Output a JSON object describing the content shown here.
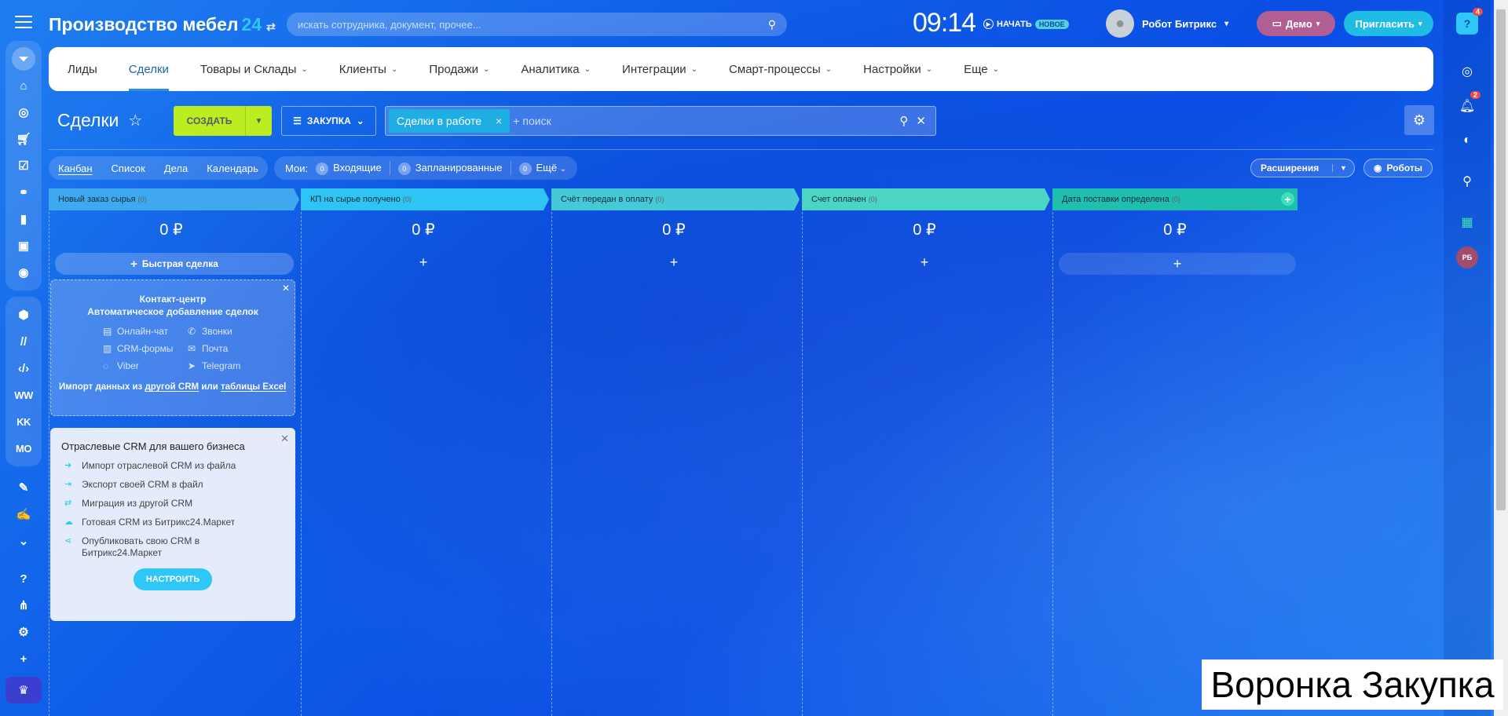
{
  "header": {
    "title": "Производство мебел",
    "title_suffix": "24",
    "search_placeholder": "искать сотрудника, документ, прочее...",
    "clock": "09:14",
    "start_label": "НАЧАТЬ",
    "new_badge": "НОВОЕ",
    "user_name": "Робот Битрикс",
    "demo_label": "Демо",
    "invite_label": "Пригласить"
  },
  "sidebar": {
    "text_items": [
      "WW",
      "KK",
      "MO"
    ]
  },
  "right_panel": {
    "help_badge": "4",
    "bell_badge": "2",
    "avatar_initials": "РБ"
  },
  "nav": {
    "items": [
      {
        "label": "Лиды",
        "dropdown": false
      },
      {
        "label": "Сделки",
        "dropdown": false,
        "active": true
      },
      {
        "label": "Товары и Склады",
        "dropdown": true
      },
      {
        "label": "Клиенты",
        "dropdown": true
      },
      {
        "label": "Продажи",
        "dropdown": true
      },
      {
        "label": "Аналитика",
        "dropdown": true
      },
      {
        "label": "Интеграции",
        "dropdown": true
      },
      {
        "label": "Смарт-процессы",
        "dropdown": true
      },
      {
        "label": "Настройки",
        "dropdown": true
      },
      {
        "label": "Еще",
        "dropdown": true
      }
    ]
  },
  "toolbar": {
    "page_title": "Сделки",
    "create_label": "СОЗДАТЬ",
    "funnel_label": "ЗАКУПКА",
    "filter_chip": "Сделки в работе",
    "filter_placeholder": "поиск",
    "filter_plus": "+"
  },
  "views": {
    "tabs": [
      "Канбан",
      "Список",
      "Дела",
      "Календарь"
    ],
    "my_label": "Мои:",
    "incoming_count": "0",
    "incoming_label": "Входящие",
    "planned_count": "0",
    "planned_label": "Запланированные",
    "more_count": "0",
    "more_label": "Ещё",
    "extensions_label": "Расширения",
    "robots_label": "Роботы"
  },
  "kanban": {
    "columns": [
      {
        "title": "Новый заказ сырья",
        "count": "(0)",
        "sum": "0 ₽",
        "color": "#3fa9f0"
      },
      {
        "title": "КП на сырье получено",
        "count": "(0)",
        "sum": "0 ₽",
        "color": "#2ec4f3"
      },
      {
        "title": "Счёт передан в оплату",
        "count": "(0)",
        "sum": "0 ₽",
        "color": "#45c9d6"
      },
      {
        "title": "Счет оплачен",
        "count": "(0)",
        "sum": "0 ₽",
        "color": "#4ad6c3"
      },
      {
        "title": "Дата поставки определена",
        "count": "(0)",
        "sum": "0 ₽",
        "color": "#1fbfb0"
      }
    ],
    "quick_deal_label": "Быстрая сделка",
    "plus": "+"
  },
  "contact_center": {
    "title_line1": "Контакт-центр",
    "title_line2": "Автоматическое добавление сделок",
    "channels": [
      "Онлайн-чат",
      "Звонки",
      "CRM-формы",
      "Почта",
      "Viber",
      "Telegram"
    ],
    "import_prefix": "Импорт данных из",
    "import_link1": "другой CRM",
    "import_mid": "или",
    "import_link2": "таблицы Excel"
  },
  "crm_card": {
    "title": "Отраслевые CRM для вашего бизнеса",
    "items": [
      "Импорт отраслевой CRM из файла",
      "Экспорт своей CRM в файл",
      "Миграция из другой CRM",
      "Готовая CRM из Битрикс24.Маркет",
      "Опубликовать свою CRM в Битрикс24.Маркет"
    ],
    "button_label": "НАСТРОИТЬ"
  },
  "caption": "Воронка Закупка"
}
